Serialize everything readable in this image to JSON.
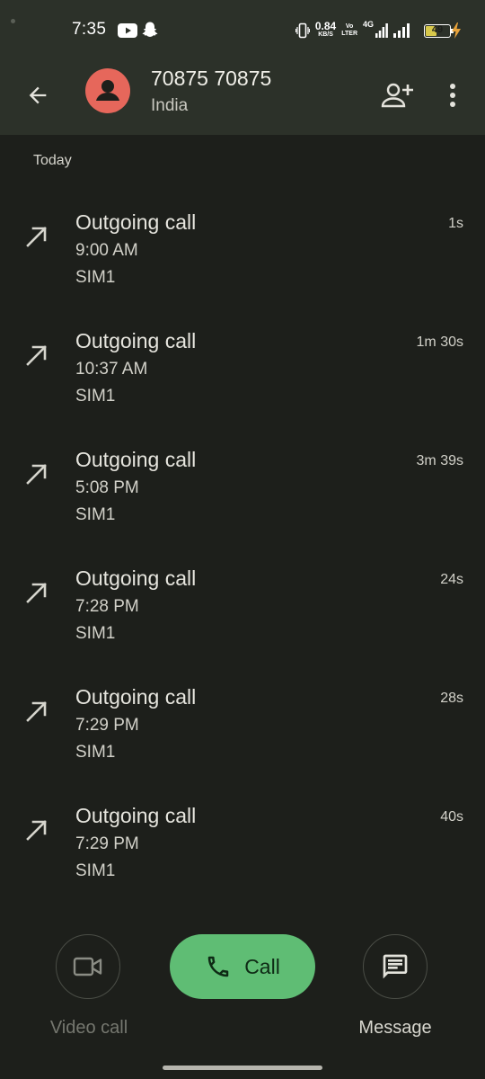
{
  "status_bar": {
    "time": "7:35",
    "net_speed_value": "0.84",
    "net_speed_unit": "KB/S",
    "volte_top": "Vo",
    "volte_mid": "LTE",
    "volte_bottom": "R",
    "network_type": "4G",
    "battery_level": "49",
    "battery_percent": 49,
    "battery_color": "#d7c84b",
    "charging_color": "#e8a33a"
  },
  "app_bar": {
    "contact_name": "70875 70875",
    "contact_country": "India",
    "avatar_color": "#e6675b"
  },
  "call_history": {
    "section_label": "Today",
    "calls": [
      {
        "type": "Outgoing call",
        "time": "9:00 AM",
        "sim": "SIM1",
        "duration": "1s"
      },
      {
        "type": "Outgoing call",
        "time": "10:37 AM",
        "sim": "SIM1",
        "duration": "1m 30s"
      },
      {
        "type": "Outgoing call",
        "time": "5:08 PM",
        "sim": "SIM1",
        "duration": "3m 39s"
      },
      {
        "type": "Outgoing call",
        "time": "7:28 PM",
        "sim": "SIM1",
        "duration": "24s"
      },
      {
        "type": "Outgoing call",
        "time": "7:29 PM",
        "sim": "SIM1",
        "duration": "28s"
      },
      {
        "type": "Outgoing call",
        "time": "7:29 PM",
        "sim": "SIM1",
        "duration": "40s"
      }
    ]
  },
  "actions": {
    "video_call_label": "Video call",
    "call_label": "Call",
    "message_label": "Message",
    "call_button_color": "#5fbd74"
  }
}
